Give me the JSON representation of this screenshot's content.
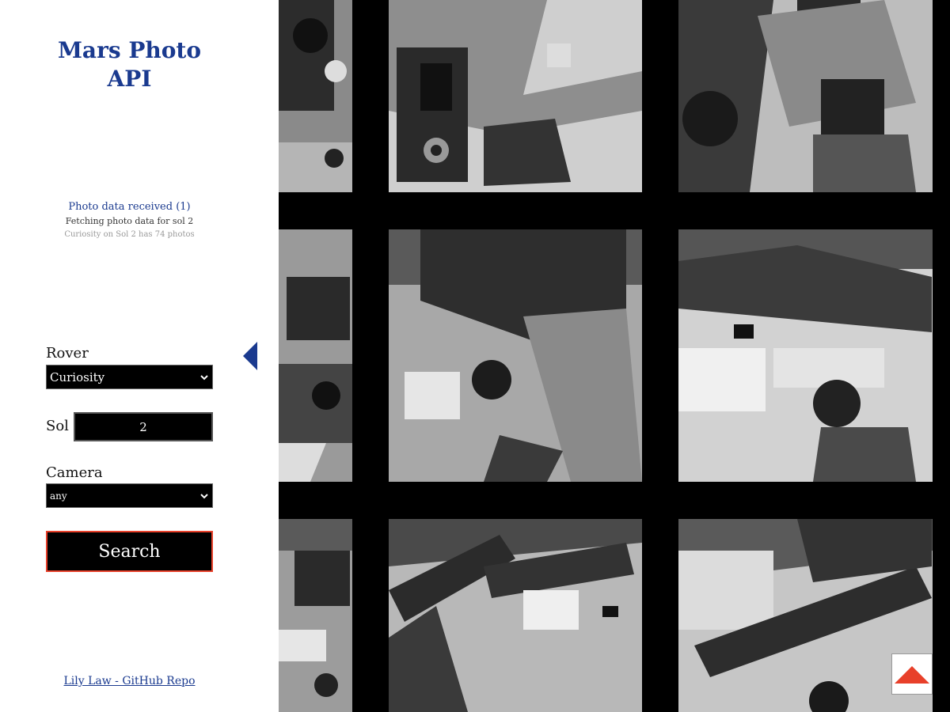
{
  "app": {
    "title_line1": "Mars Photo",
    "title_line2": "API"
  },
  "status": {
    "received": "Photo data received (1)",
    "fetching": "Fetching photo data for sol 2",
    "summary": "Curiosity on Sol 2 has 74 photos"
  },
  "form": {
    "rover_label": "Rover",
    "rover_value": "Curiosity",
    "sol_label": "Sol",
    "sol_value": "2",
    "camera_label": "Camera",
    "camera_value": "any",
    "search_label": "Search"
  },
  "footer": {
    "link_text": "Lily Law - GitHub Repo"
  },
  "icons": {
    "collapse": "chevron-left-icon",
    "scroll_top": "arrow-up-icon",
    "select": "chevron-down-icon"
  },
  "colors": {
    "accent": "#1a3a8f",
    "search_border": "#e8402a",
    "scroll_arrow": "#e8402a"
  },
  "gallery": {
    "photos": [
      {
        "name": "rover-photo-1"
      },
      {
        "name": "rover-photo-2"
      },
      {
        "name": "rover-photo-3"
      },
      {
        "name": "rover-photo-4"
      },
      {
        "name": "rover-photo-5"
      },
      {
        "name": "rover-photo-6"
      },
      {
        "name": "rover-photo-7"
      },
      {
        "name": "rover-photo-8"
      },
      {
        "name": "rover-photo-9"
      }
    ]
  }
}
